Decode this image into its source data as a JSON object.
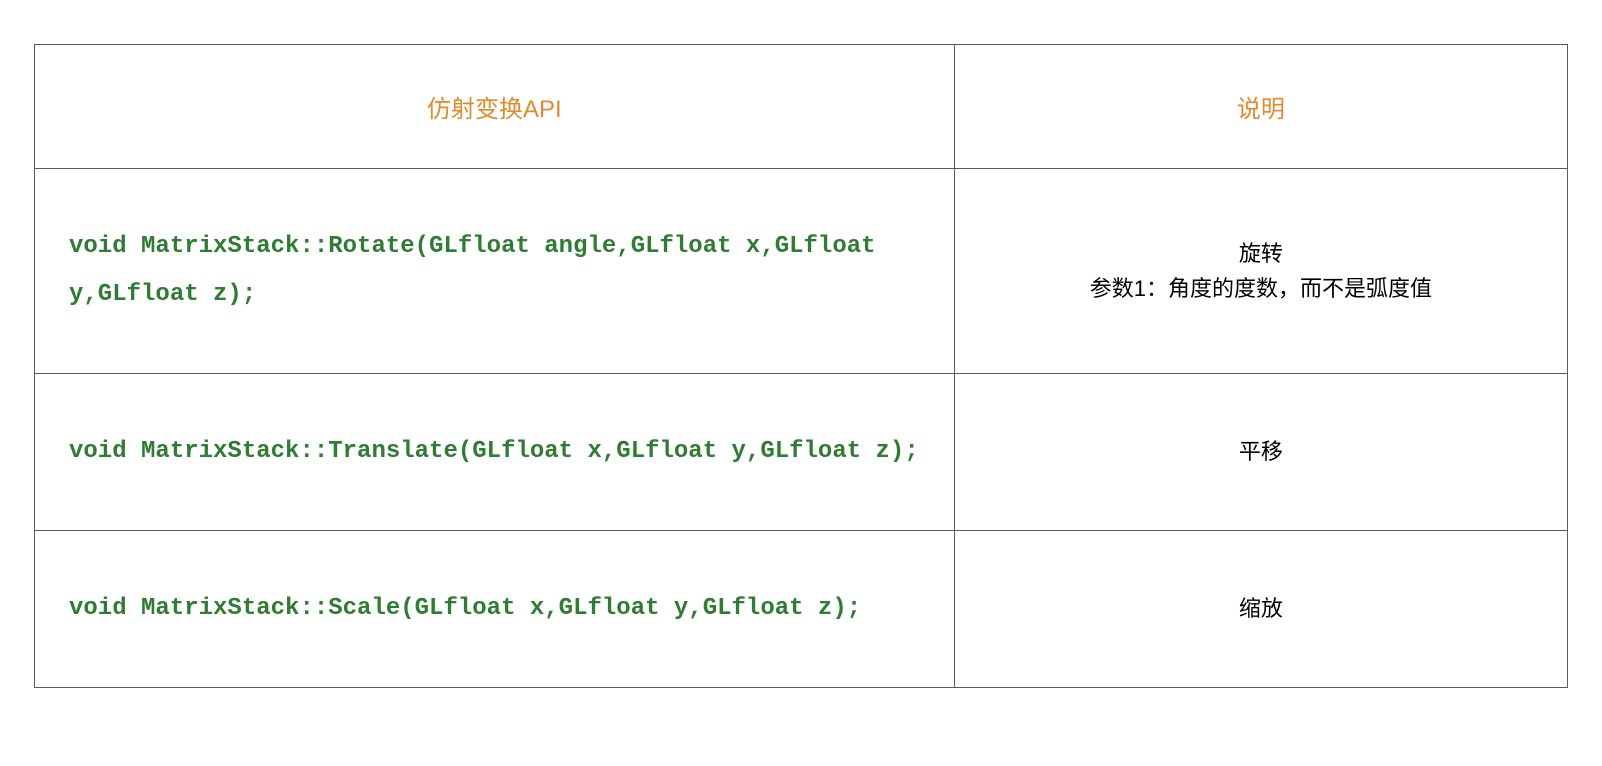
{
  "header": {
    "col1": "仿射变换API",
    "col2": "说明"
  },
  "rows": [
    {
      "api": "void MatrixStack::Rotate(GLfloat angle,GLfloat x,GLfloat y,GLfloat z);",
      "desc": "旋转\n参数1：角度的度数，而不是弧度值"
    },
    {
      "api": "void MatrixStack::Translate(GLfloat x,GLfloat y,GLfloat z);",
      "desc": "平移"
    },
    {
      "api": "void MatrixStack::Scale(GLfloat x,GLfloat y,GLfloat z);",
      "desc": "缩放"
    }
  ]
}
